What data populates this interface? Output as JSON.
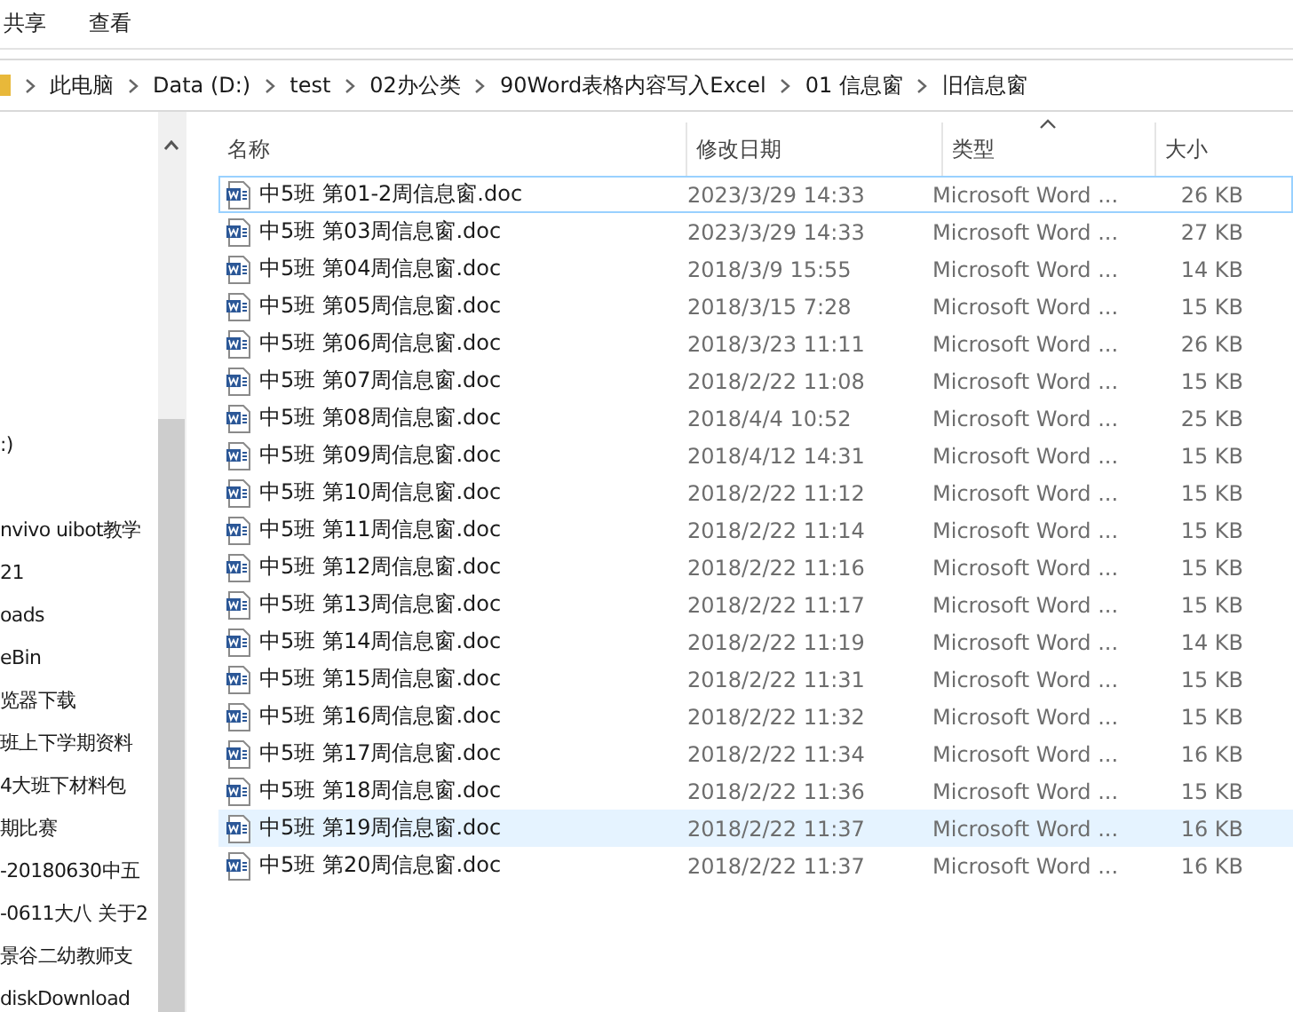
{
  "ribbon_tabs": [
    {
      "label": "共享"
    },
    {
      "label": "查看"
    }
  ],
  "breadcrumb": [
    "此电脑",
    "Data (D:)",
    "test",
    "02办公类",
    "90Word表格内容写入Excel",
    "01 信息窗",
    "旧信息窗"
  ],
  "sidebar": {
    "items": [
      ":)",
      "nvivo uibot教学",
      "21",
      "oads",
      "eBin",
      "览器下载",
      "班上下学期资料",
      "4大班下材料包",
      "期比赛",
      "-20180630中五",
      "-0611大八 关于2",
      "景谷二幼教师支",
      "diskDownload"
    ]
  },
  "table": {
    "columns": [
      {
        "label": "名称",
        "sorted": false
      },
      {
        "label": "修改日期",
        "sorted": false
      },
      {
        "label": "类型",
        "sorted": true
      },
      {
        "label": "大小",
        "sorted": false
      }
    ],
    "rows": [
      {
        "name": "中5班 第01-2周信息窗.doc",
        "date": "2023/3/29 14:33",
        "type": "Microsoft Word ...",
        "size": "26 KB",
        "selected": false,
        "focused": true
      },
      {
        "name": "中5班 第03周信息窗.doc",
        "date": "2023/3/29 14:33",
        "type": "Microsoft Word ...",
        "size": "27 KB",
        "selected": false,
        "focused": false
      },
      {
        "name": "中5班 第04周信息窗.doc",
        "date": "2018/3/9 15:55",
        "type": "Microsoft Word ...",
        "size": "14 KB",
        "selected": false,
        "focused": false
      },
      {
        "name": "中5班 第05周信息窗.doc",
        "date": "2018/3/15 7:28",
        "type": "Microsoft Word ...",
        "size": "15 KB",
        "selected": false,
        "focused": false
      },
      {
        "name": "中5班 第06周信息窗.doc",
        "date": "2018/3/23 11:11",
        "type": "Microsoft Word ...",
        "size": "26 KB",
        "selected": false,
        "focused": false
      },
      {
        "name": "中5班 第07周信息窗.doc",
        "date": "2018/2/22 11:08",
        "type": "Microsoft Word ...",
        "size": "15 KB",
        "selected": false,
        "focused": false
      },
      {
        "name": "中5班 第08周信息窗.doc",
        "date": "2018/4/4 10:52",
        "type": "Microsoft Word ...",
        "size": "25 KB",
        "selected": false,
        "focused": false
      },
      {
        "name": "中5班 第09周信息窗.doc",
        "date": "2018/4/12 14:31",
        "type": "Microsoft Word ...",
        "size": "15 KB",
        "selected": false,
        "focused": false
      },
      {
        "name": "中5班 第10周信息窗.doc",
        "date": "2018/2/22 11:12",
        "type": "Microsoft Word ...",
        "size": "15 KB",
        "selected": false,
        "focused": false
      },
      {
        "name": "中5班 第11周信息窗.doc",
        "date": "2018/2/22 11:14",
        "type": "Microsoft Word ...",
        "size": "15 KB",
        "selected": false,
        "focused": false
      },
      {
        "name": "中5班 第12周信息窗.doc",
        "date": "2018/2/22 11:16",
        "type": "Microsoft Word ...",
        "size": "15 KB",
        "selected": false,
        "focused": false
      },
      {
        "name": "中5班 第13周信息窗.doc",
        "date": "2018/2/22 11:17",
        "type": "Microsoft Word ...",
        "size": "15 KB",
        "selected": false,
        "focused": false
      },
      {
        "name": "中5班 第14周信息窗.doc",
        "date": "2018/2/22 11:19",
        "type": "Microsoft Word ...",
        "size": "14 KB",
        "selected": false,
        "focused": false
      },
      {
        "name": "中5班 第15周信息窗.doc",
        "date": "2018/2/22 11:31",
        "type": "Microsoft Word ...",
        "size": "15 KB",
        "selected": false,
        "focused": false
      },
      {
        "name": "中5班 第16周信息窗.doc",
        "date": "2018/2/22 11:32",
        "type": "Microsoft Word ...",
        "size": "15 KB",
        "selected": false,
        "focused": false
      },
      {
        "name": "中5班 第17周信息窗.doc",
        "date": "2018/2/22 11:34",
        "type": "Microsoft Word ...",
        "size": "16 KB",
        "selected": false,
        "focused": false
      },
      {
        "name": "中5班 第18周信息窗.doc",
        "date": "2018/2/22 11:36",
        "type": "Microsoft Word ...",
        "size": "15 KB",
        "selected": false,
        "focused": false
      },
      {
        "name": "中5班 第19周信息窗.doc",
        "date": "2018/2/22 11:37",
        "type": "Microsoft Word ...",
        "size": "16 KB",
        "selected": true,
        "focused": false
      },
      {
        "name": "中5班 第20周信息窗.doc",
        "date": "2018/2/22 11:37",
        "type": "Microsoft Word ...",
        "size": "16 KB",
        "selected": false,
        "focused": false
      }
    ]
  }
}
